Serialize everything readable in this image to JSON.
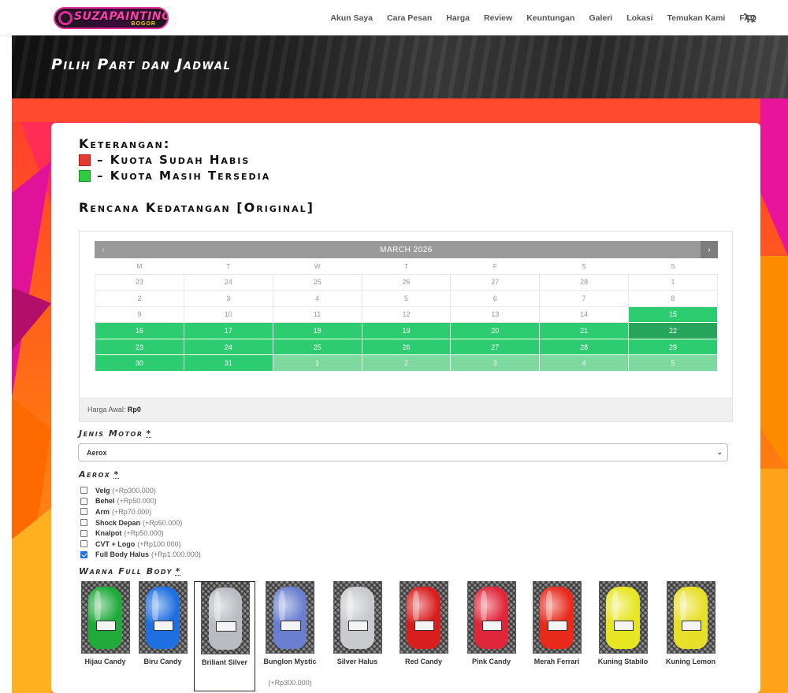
{
  "brand": {
    "logo_text": "SUZAPAINTING",
    "logo_sub": "BOGOR"
  },
  "nav": [
    "Akun Saya",
    "Cara Pesan",
    "Harga",
    "Review",
    "Keuntungan",
    "Galeri",
    "Lokasi",
    "Temukan Kami",
    "FAQ"
  ],
  "hero": {
    "title": "Pilih Part dan Jadwal"
  },
  "legend": {
    "heading": "Keterangan:",
    "habis": "– Kuota Sudah Habis",
    "tersedia": "– Kuota Masih Tersedia",
    "habis_color": "#e53935",
    "tersedia_color": "#2ecc40"
  },
  "plan_title": "Rencana Kedatangan [Original]",
  "calendar": {
    "month": "MARCH 2026",
    "prev": "‹",
    "next": "›",
    "weekdays": [
      "M",
      "T",
      "W",
      "T",
      "F",
      "S",
      "S"
    ],
    "weeks": [
      [
        {
          "d": "23",
          "s": "muted"
        },
        {
          "d": "24",
          "s": "muted"
        },
        {
          "d": "25",
          "s": "muted"
        },
        {
          "d": "26",
          "s": "muted"
        },
        {
          "d": "27",
          "s": "muted"
        },
        {
          "d": "28",
          "s": "muted"
        },
        {
          "d": "1",
          "s": "muted"
        }
      ],
      [
        {
          "d": "2",
          "s": "muted"
        },
        {
          "d": "3",
          "s": "muted"
        },
        {
          "d": "4",
          "s": "muted"
        },
        {
          "d": "5",
          "s": "muted"
        },
        {
          "d": "6",
          "s": "muted"
        },
        {
          "d": "7",
          "s": "muted"
        },
        {
          "d": "8",
          "s": "muted"
        }
      ],
      [
        {
          "d": "9",
          "s": "muted"
        },
        {
          "d": "10",
          "s": "muted"
        },
        {
          "d": "11",
          "s": "muted"
        },
        {
          "d": "12",
          "s": "muted"
        },
        {
          "d": "13",
          "s": "muted"
        },
        {
          "d": "14",
          "s": "muted"
        },
        {
          "d": "15",
          "s": "av"
        }
      ],
      [
        {
          "d": "16",
          "s": "av"
        },
        {
          "d": "17",
          "s": "av"
        },
        {
          "d": "18",
          "s": "av"
        },
        {
          "d": "19",
          "s": "av"
        },
        {
          "d": "20",
          "s": "av"
        },
        {
          "d": "21",
          "s": "av"
        },
        {
          "d": "22",
          "s": "sel"
        }
      ],
      [
        {
          "d": "23",
          "s": "av"
        },
        {
          "d": "24",
          "s": "av"
        },
        {
          "d": "25",
          "s": "av"
        },
        {
          "d": "26",
          "s": "av"
        },
        {
          "d": "27",
          "s": "av"
        },
        {
          "d": "28",
          "s": "av"
        },
        {
          "d": "29",
          "s": "av"
        }
      ],
      [
        {
          "d": "30",
          "s": "av"
        },
        {
          "d": "31",
          "s": "av"
        },
        {
          "d": "1",
          "s": "next"
        },
        {
          "d": "2",
          "s": "next"
        },
        {
          "d": "3",
          "s": "next"
        },
        {
          "d": "4",
          "s": "next"
        },
        {
          "d": "5",
          "s": "next"
        }
      ]
    ],
    "price_label": "Harga Awal:",
    "price_value": "Rp0"
  },
  "form": {
    "motor_label": "Jenis Motor",
    "motor_value": "Aerox",
    "parts_label": "Aerox",
    "parts": [
      {
        "name": "Velg",
        "price": "(+Rp300.000)",
        "checked": false
      },
      {
        "name": "Behel",
        "price": "(+Rp50.000)",
        "checked": false
      },
      {
        "name": "Arm",
        "price": "(+Rp70.000)",
        "checked": false
      },
      {
        "name": "Shock Depan",
        "price": "(+Rp50.000)",
        "checked": false
      },
      {
        "name": "Knalpot",
        "price": "(+Rp50.000)",
        "checked": false
      },
      {
        "name": "CVT + Logo",
        "price": "(+Rp100.000)",
        "checked": false
      },
      {
        "name": "Full Body Halus",
        "price": "(+Rp1.000.000)",
        "checked": true
      }
    ],
    "color_label": "Warna Full Body",
    "req": "*"
  },
  "colors": [
    {
      "name": "Hijau Candy",
      "price": "",
      "color": "#1faa3a",
      "selected": false
    },
    {
      "name": "Biru Candy",
      "price": "",
      "color": "#1f6fe0",
      "selected": false
    },
    {
      "name": "Briliant Silver",
      "price": "",
      "color": "#b9bcc2",
      "selected": true
    },
    {
      "name": "Bunglon Mystic",
      "price": "(+Rp300.000)",
      "color": "#6a7fd0",
      "selected": false
    },
    {
      "name": "Silver Halus",
      "price": "",
      "color": "#c8cacd",
      "selected": false
    },
    {
      "name": "Red Candy",
      "price": "",
      "color": "#d91e1e",
      "selected": false
    },
    {
      "name": "Pink Candy",
      "price": "",
      "color": "#e0263a",
      "selected": false
    },
    {
      "name": "Merah Ferrari",
      "price": "",
      "color": "#e82a1a",
      "selected": false
    },
    {
      "name": "Kuning Stabilo",
      "price": "",
      "color": "#e6e622",
      "selected": false
    },
    {
      "name": "Kuning Lemon",
      "price": "",
      "color": "#e8df2a",
      "selected": false
    }
  ]
}
